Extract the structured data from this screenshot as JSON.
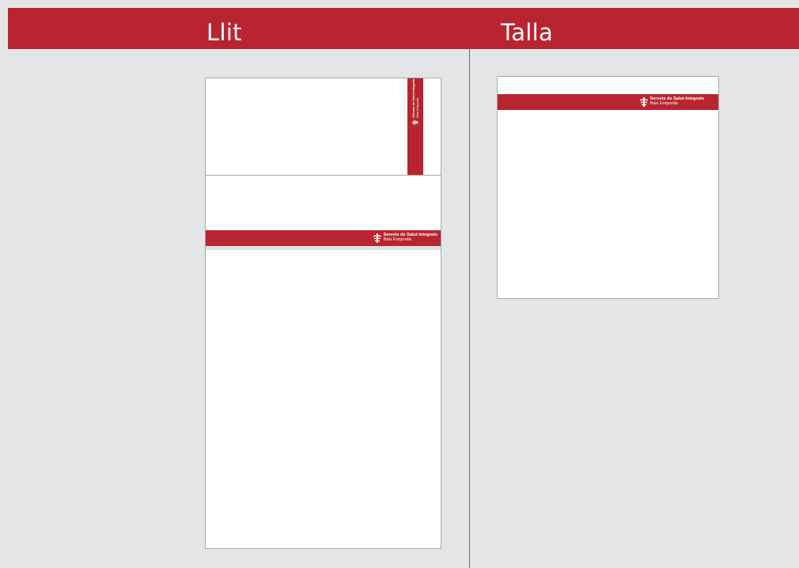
{
  "columns": [
    {
      "title": "Llit"
    },
    {
      "title": "Talla"
    }
  ],
  "logo": {
    "name": "Serveis de Salut Integrats",
    "subtitle": "Baix Empordà"
  },
  "colors": {
    "brand_red": "#b82530",
    "background": "#e4e5e7",
    "sheet": "#ffffff",
    "sheet_border": "#a9a9a9"
  }
}
